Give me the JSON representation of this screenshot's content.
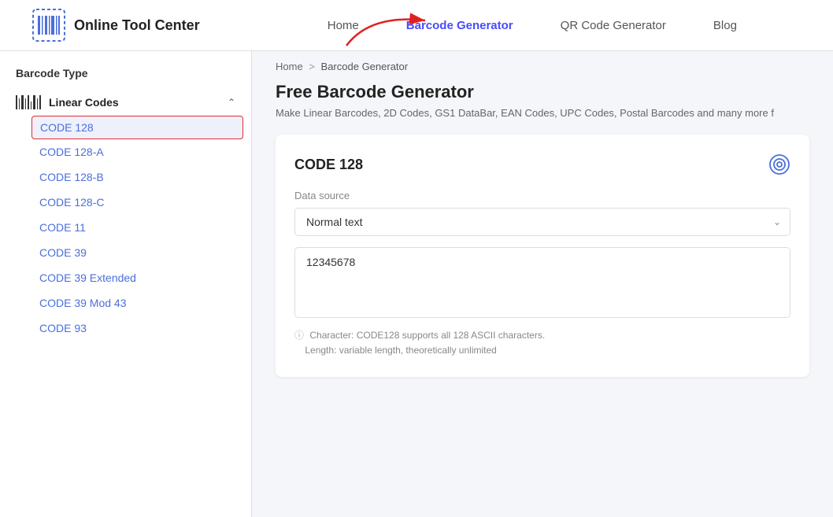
{
  "header": {
    "logo_text": "Online Tool Center",
    "nav_items": [
      {
        "label": "Home",
        "active": false
      },
      {
        "label": "Barcode Generator",
        "active": true
      },
      {
        "label": "QR Code Generator",
        "active": false
      },
      {
        "label": "Blog",
        "active": false
      }
    ]
  },
  "sidebar": {
    "section_title": "Barcode Type",
    "groups": [
      {
        "label": "Linear Codes",
        "expanded": true,
        "items": [
          {
            "label": "CODE 128",
            "selected": true
          },
          {
            "label": "CODE 128-A",
            "selected": false
          },
          {
            "label": "CODE 128-B",
            "selected": false
          },
          {
            "label": "CODE 128-C",
            "selected": false
          },
          {
            "label": "CODE 11",
            "selected": false
          },
          {
            "label": "CODE 39",
            "selected": false
          },
          {
            "label": "CODE 39 Extended",
            "selected": false
          },
          {
            "label": "CODE 39 Mod 43",
            "selected": false
          },
          {
            "label": "CODE 93",
            "selected": false
          }
        ]
      }
    ]
  },
  "breadcrumb": {
    "home": "Home",
    "separator": ">",
    "current": "Barcode Generator"
  },
  "main": {
    "page_title": "Free Barcode Generator",
    "page_subtitle": "Make Linear Barcodes, 2D Codes, GS1 DataBar, EAN Codes, UPC Codes, Postal Barcodes and many more f",
    "card": {
      "title": "CODE 128",
      "data_source_label": "Data source",
      "select_value": "Normal text",
      "textarea_value": "12345678",
      "hint_line1": "Character: CODE128 supports all 128 ASCII characters.",
      "hint_line2": "Length: variable length, theoretically unlimited"
    }
  }
}
